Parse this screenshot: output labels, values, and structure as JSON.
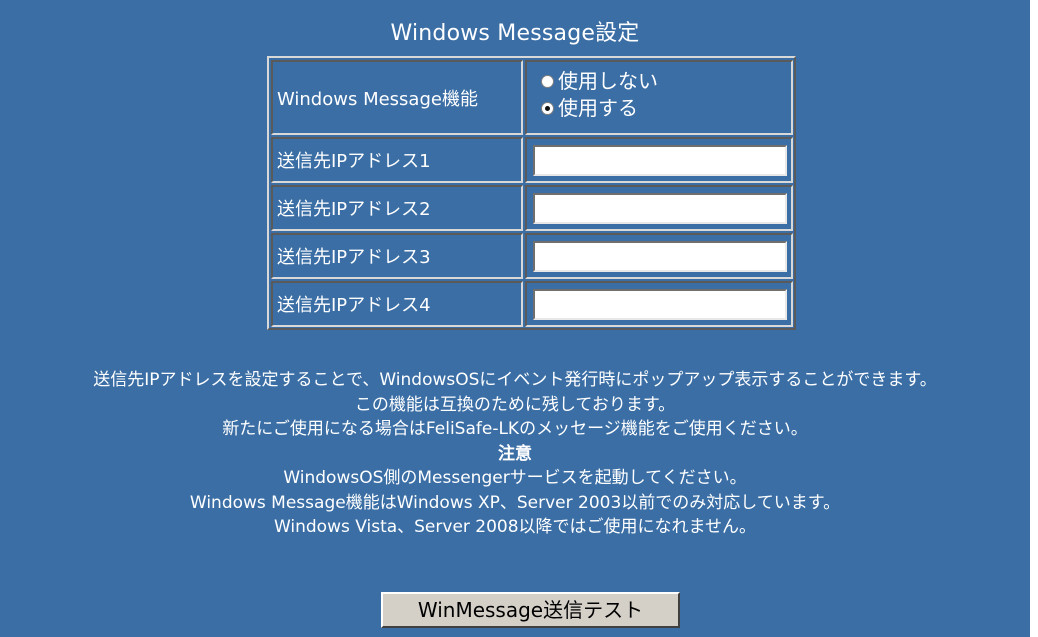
{
  "page": {
    "title": "Windows Message設定"
  },
  "settings": {
    "function_label": "Windows Message機能",
    "options": [
      {
        "label": "使用しない",
        "checked": false
      },
      {
        "label": "使用する",
        "checked": true
      }
    ],
    "ip_rows": [
      {
        "label": "送信先IPアドレス1",
        "value": ""
      },
      {
        "label": "送信先IPアドレス2",
        "value": ""
      },
      {
        "label": "送信先IPアドレス3",
        "value": ""
      },
      {
        "label": "送信先IPアドレス4",
        "value": ""
      }
    ]
  },
  "info": {
    "line1": "送信先IPアドレスを設定することで、WindowsOSにイベント発行時にポップアップ表示することができます。",
    "line2": "この機能は互換のために残しております。",
    "line3": "新たにご使用になる場合はFeliSafe-LKのメッセージ機能をご使用ください。",
    "note_title": "注意",
    "note1": "WindowsOS側のMessengerサービスを起動してください。",
    "note2": "Windows Message機能はWindows XP、Server 2003以前でのみ対応しています。",
    "note3": "Windows Vista、Server 2008以降ではご使用になれません。"
  },
  "actions": {
    "test_button": "WinMessage送信テスト"
  },
  "colors": {
    "background": "#3a6ea5",
    "text": "#ffffff",
    "button_face": "#d4d0c8"
  }
}
